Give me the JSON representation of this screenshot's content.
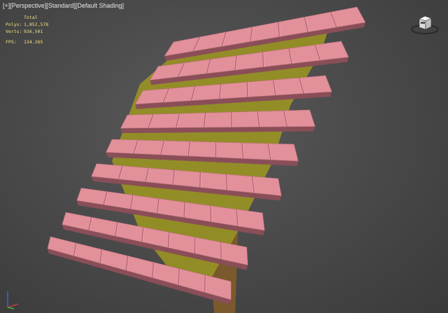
{
  "viewport": {
    "label_parts": [
      "[+]",
      "[Perspective]",
      "[Standard]",
      "[Default Shading]"
    ]
  },
  "stats": {
    "heading": "Total",
    "polys_label": "Polys:",
    "polys_value": "1,852,578",
    "verts_label": "Verts:",
    "verts_value": "926,501",
    "fps_label": "FPS:",
    "fps_value": "134.265"
  },
  "icons": {
    "viewcube": "viewcube-icon",
    "axis": "axis-tripod-icon"
  },
  "colors": {
    "background": "#4b4b4b",
    "stats_text": "#f0e080",
    "shingle_face": "#e2909a",
    "shingle_shadow": "#8a4e58",
    "batten": "#9a9422",
    "rafter": "#7a5a2c"
  },
  "scene": {
    "shingle_rows": 9,
    "tiles_per_row": [
      7,
      7,
      7,
      7,
      7,
      7,
      7,
      7,
      7
    ]
  }
}
